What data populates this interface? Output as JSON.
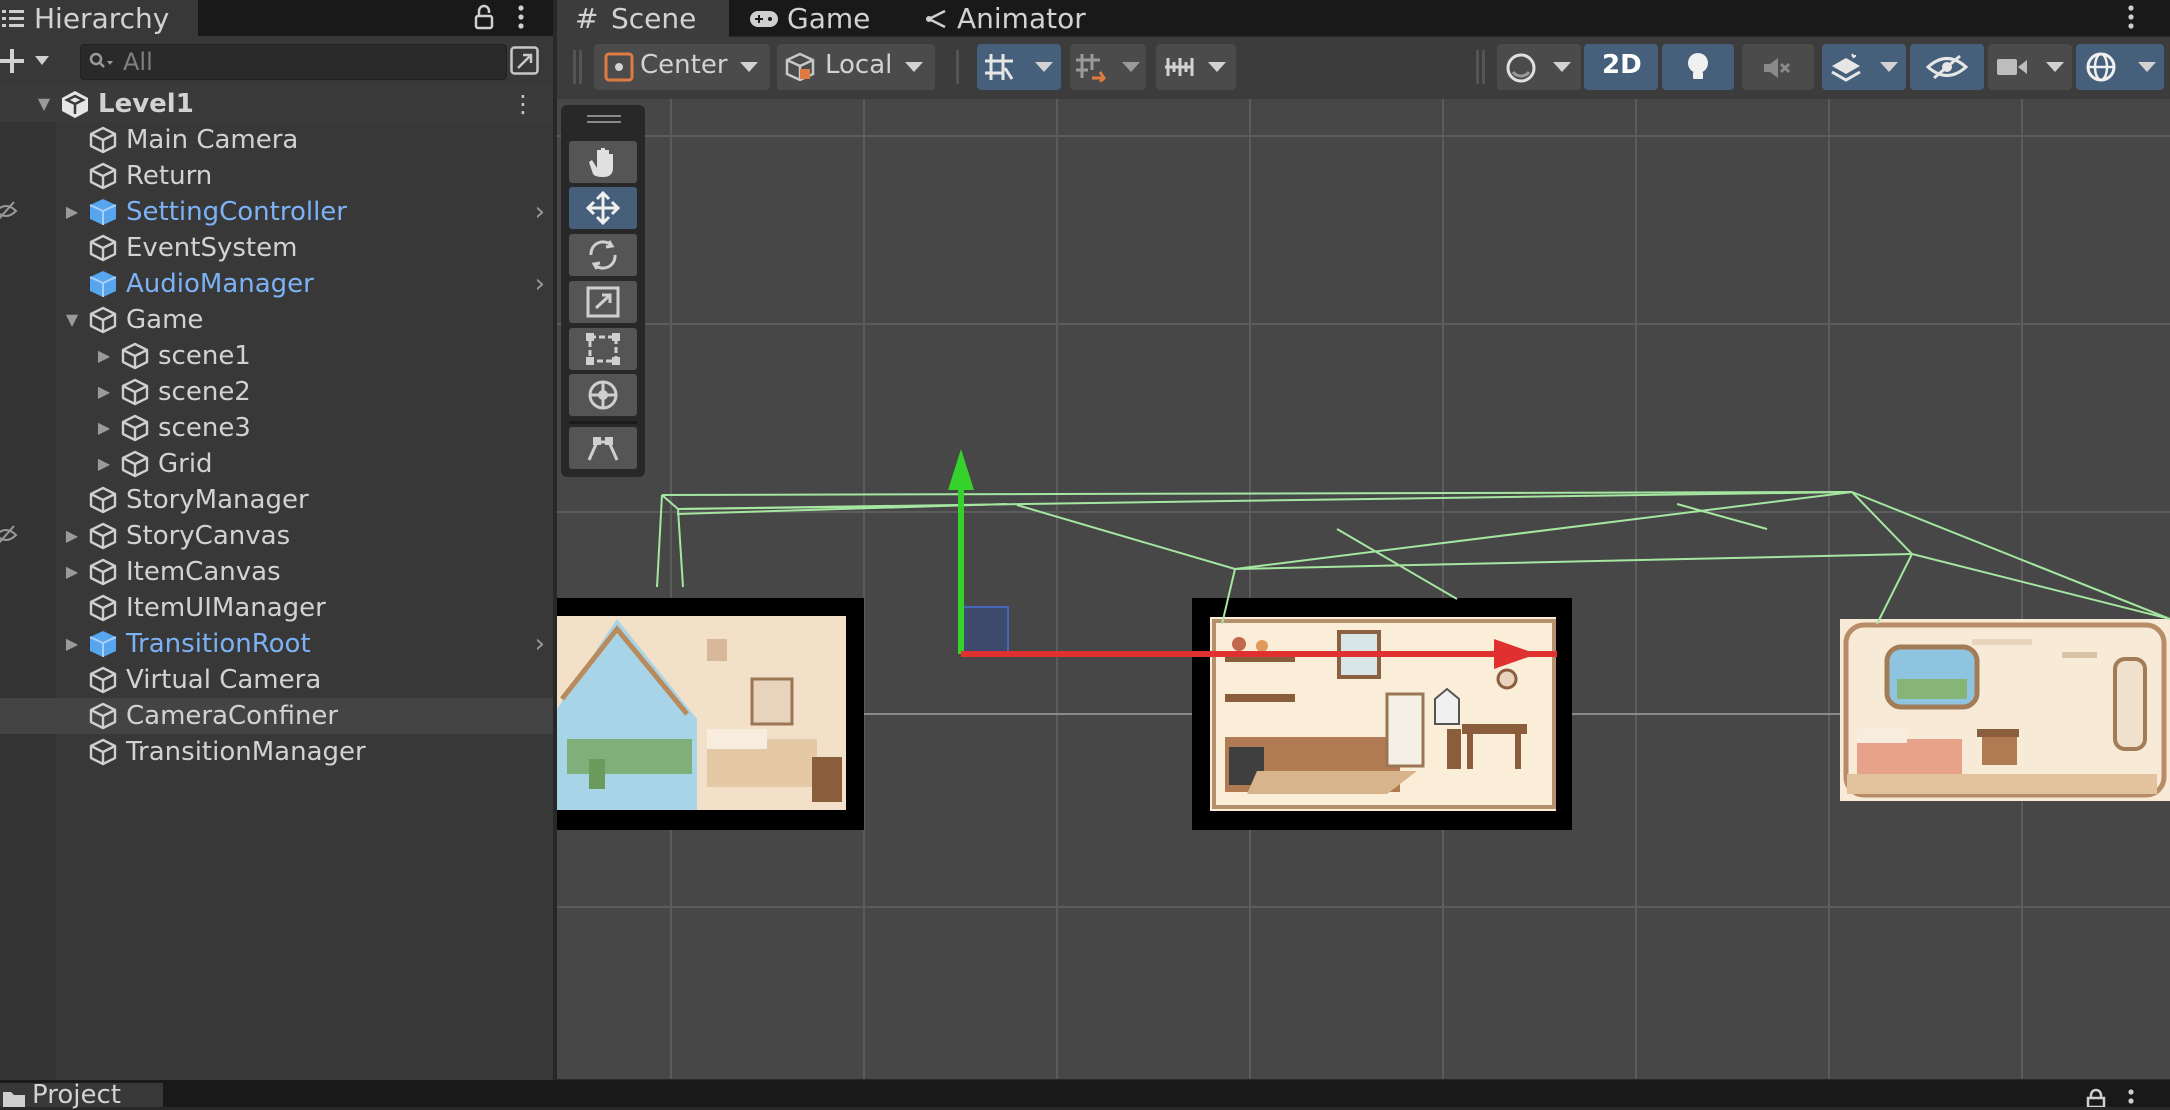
{
  "hierarchy": {
    "tab_label": "Hierarchy",
    "search_placeholder": "All",
    "rows": [
      {
        "label": "Level1",
        "depth": 0,
        "root": true,
        "expanded": true
      },
      {
        "label": "Main Camera",
        "depth": 1
      },
      {
        "label": "Return",
        "depth": 1
      },
      {
        "label": "SettingController",
        "depth": 1,
        "prefab": true,
        "expandable": true,
        "hidden_in_scene": true
      },
      {
        "label": "EventSystem",
        "depth": 1
      },
      {
        "label": "AudioManager",
        "depth": 1,
        "prefab": true
      },
      {
        "label": "Game",
        "depth": 1,
        "expandable": true,
        "expanded": true
      },
      {
        "label": "scene1",
        "depth": 2,
        "expandable": true
      },
      {
        "label": "scene2",
        "depth": 2,
        "expandable": true
      },
      {
        "label": "scene3",
        "depth": 2,
        "expandable": true
      },
      {
        "label": "Grid",
        "depth": 2,
        "expandable": true
      },
      {
        "label": "StoryManager",
        "depth": 1
      },
      {
        "label": "StoryCanvas",
        "depth": 1,
        "expandable": true,
        "hidden_in_scene": true
      },
      {
        "label": "ItemCanvas",
        "depth": 1,
        "expandable": true
      },
      {
        "label": "ItemUIManager",
        "depth": 1
      },
      {
        "label": "TransitionRoot",
        "depth": 1,
        "prefab": true,
        "expandable": true
      },
      {
        "label": "Virtual Camera",
        "depth": 1
      },
      {
        "label": "CameraConfiner",
        "depth": 1,
        "selected": true
      },
      {
        "label": "TransitionManager",
        "depth": 1
      }
    ]
  },
  "scene_tabs": {
    "scene": "Scene",
    "game": "Game",
    "animator": "Animator"
  },
  "toolbar": {
    "pivot_mode": "Center",
    "pivot_rotation": "Local",
    "mode_2d": "2D"
  },
  "bottom": {
    "project_tab": "Project"
  },
  "colors": {
    "prefab_text": "#7cb2f5",
    "selection_blue": "#46607c",
    "gizmo_green": "#7fd67f",
    "axis_y": "#35d22b",
    "axis_x": "#e13030"
  }
}
